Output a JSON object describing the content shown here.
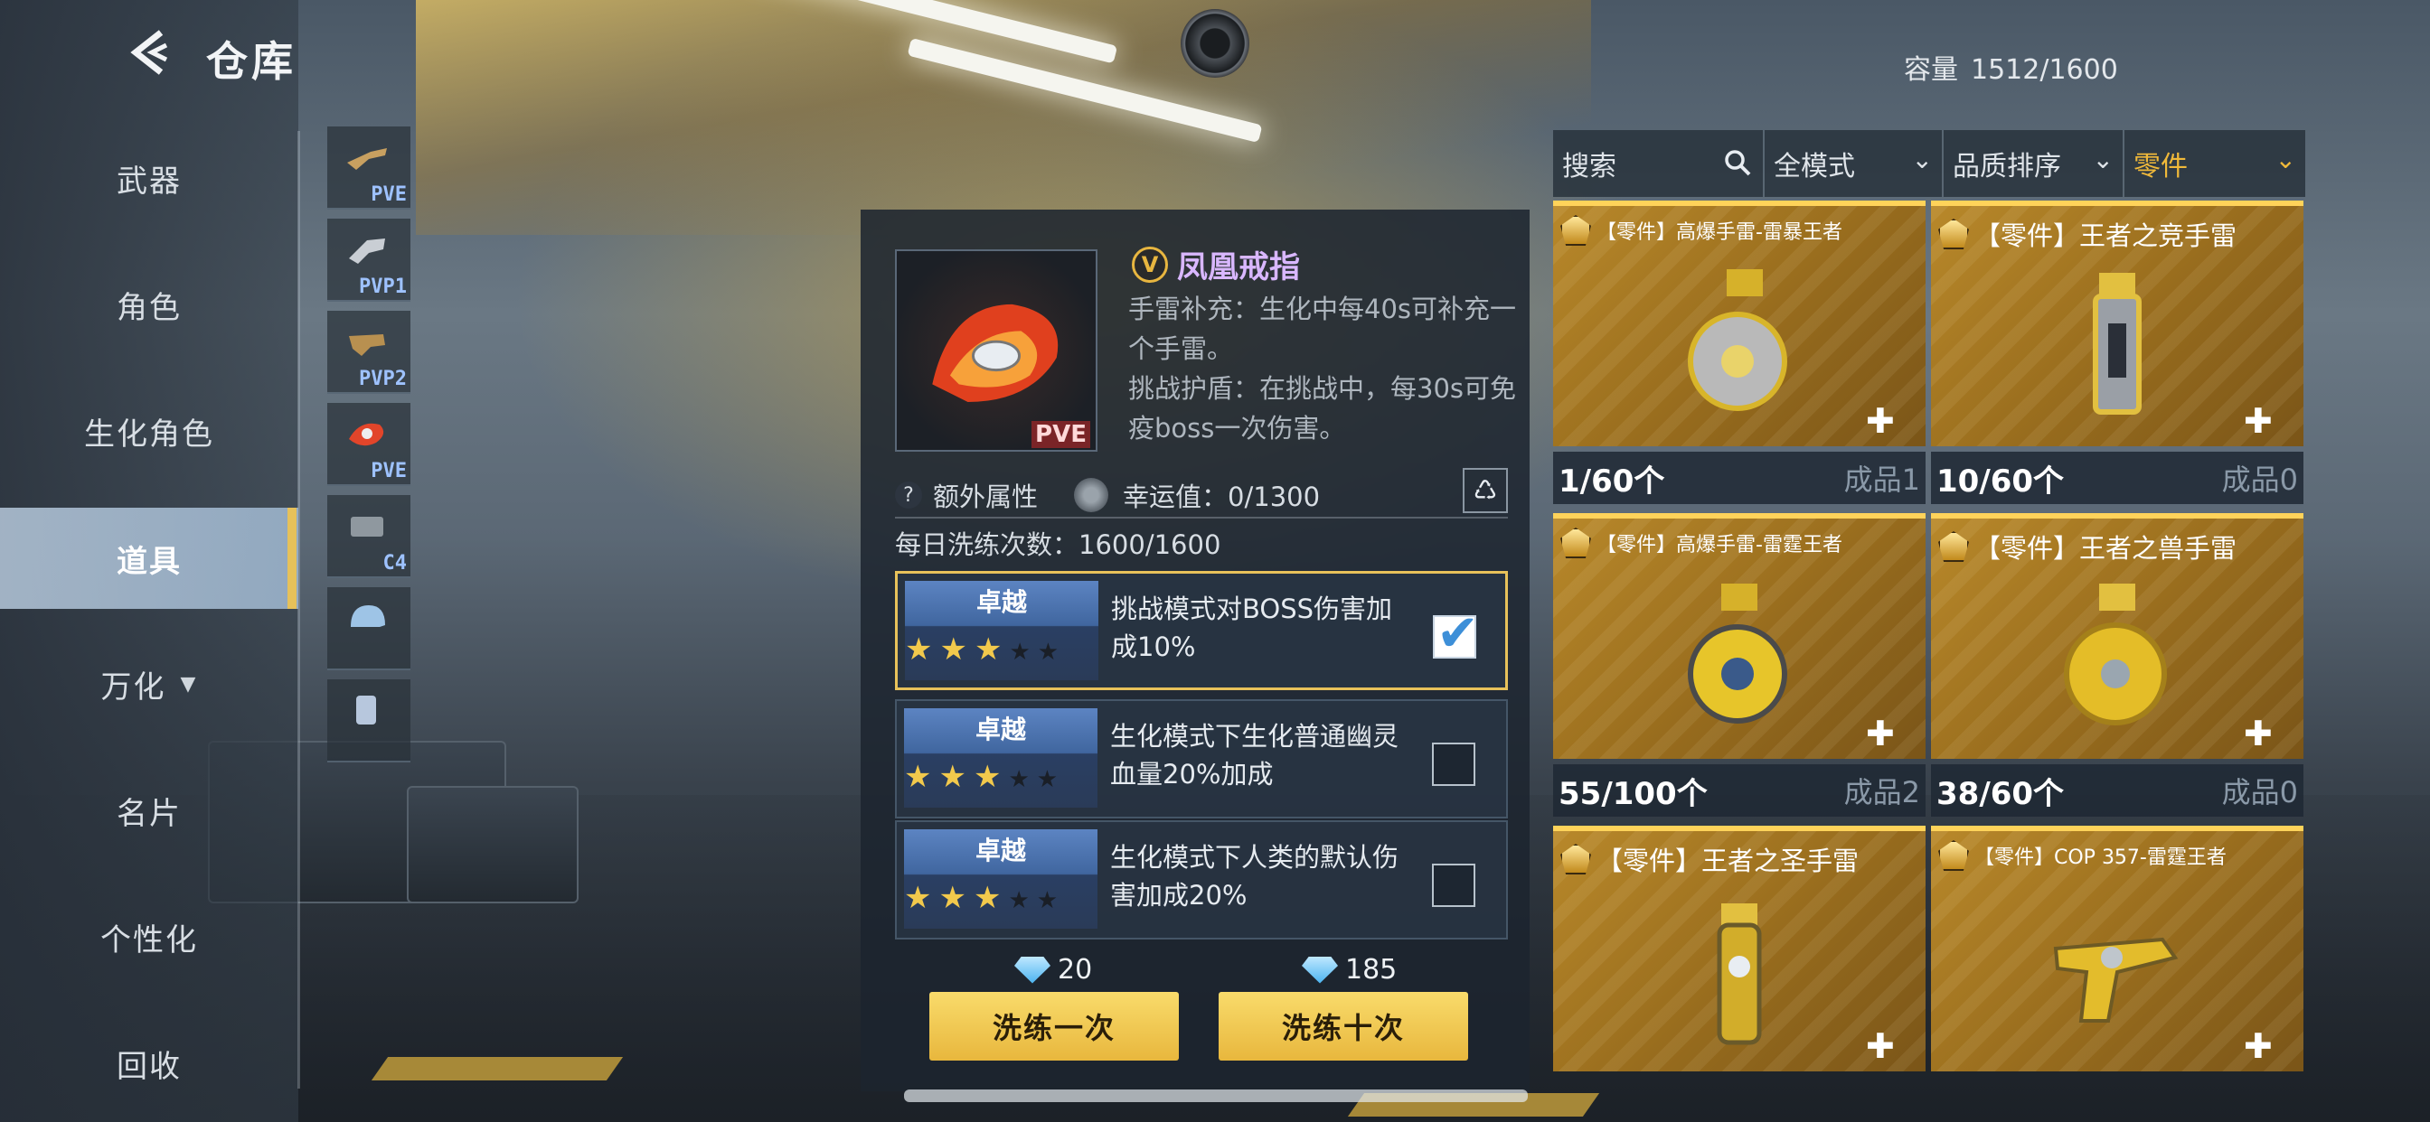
{
  "header": {
    "title": "仓库",
    "capacity_label": "容量",
    "capacity_value": "1512/1600"
  },
  "sidebar": {
    "items": [
      {
        "label": "武器"
      },
      {
        "label": "角色"
      },
      {
        "label": "生化角色"
      },
      {
        "label": "道具",
        "active": true
      },
      {
        "label": "万化"
      },
      {
        "label": "名片"
      },
      {
        "label": "个性化"
      },
      {
        "label": "回收"
      }
    ]
  },
  "thumbnails": [
    {
      "tag": "PVE"
    },
    {
      "tag": "PVP1"
    },
    {
      "tag": "PVP2"
    },
    {
      "tag": "PVE"
    },
    {
      "tag": "C4"
    },
    {
      "tag": ""
    },
    {
      "tag": ""
    }
  ],
  "detail": {
    "item_name": "凤凰戒指",
    "item_mode_tag": "PVE",
    "desc1": "手雷补充：生化中每40s可补充一个手雷。",
    "desc2": "挑战护盾：在挑战中，每30s可免疫boss一次伤害。",
    "extra_attr_label": "额外属性",
    "luck_label": "幸运值：0/1300",
    "daily_label": "每日洗练次数：",
    "daily_value": "1600/1600",
    "options": [
      {
        "grade": "卓越",
        "stars": 3,
        "max_stars": 5,
        "text": "挑战模式对BOSS伤害加成10%",
        "checked": true
      },
      {
        "grade": "卓越",
        "stars": 3,
        "max_stars": 5,
        "text": "生化模式下生化普通幽灵血量20%加成",
        "checked": false
      },
      {
        "grade": "卓越",
        "stars": 3,
        "max_stars": 5,
        "text": "生化模式下人类的默认伤害加成20%",
        "checked": false
      }
    ],
    "cost_once": "20",
    "cost_ten": "185",
    "btn_once": "洗练一次",
    "btn_ten": "洗练十次"
  },
  "filters": {
    "search_placeholder": "搜索",
    "mode": "全模式",
    "sort": "品质排序",
    "category": "零件"
  },
  "inventory": [
    {
      "name": "【零件】高爆手雷-雷暴王者",
      "count": "1/60个",
      "made": "成品1"
    },
    {
      "name": "【零件】王者之竞手雷",
      "count": "10/60个",
      "made": "成品0"
    },
    {
      "name": "【零件】高爆手雷-雷霆王者",
      "count": "55/100个",
      "made": "成品2"
    },
    {
      "name": "【零件】王者之兽手雷",
      "count": "38/60个",
      "made": "成品0"
    },
    {
      "name": "【零件】王者之圣手雷",
      "count": "",
      "made": ""
    },
    {
      "name": "【零件】COP 357-雷霆王者",
      "count": "",
      "made": ""
    }
  ],
  "colors": {
    "accent_gold": "#f0b93a",
    "active_nav": "#e6c15a",
    "card_gold": "#b8882a"
  }
}
